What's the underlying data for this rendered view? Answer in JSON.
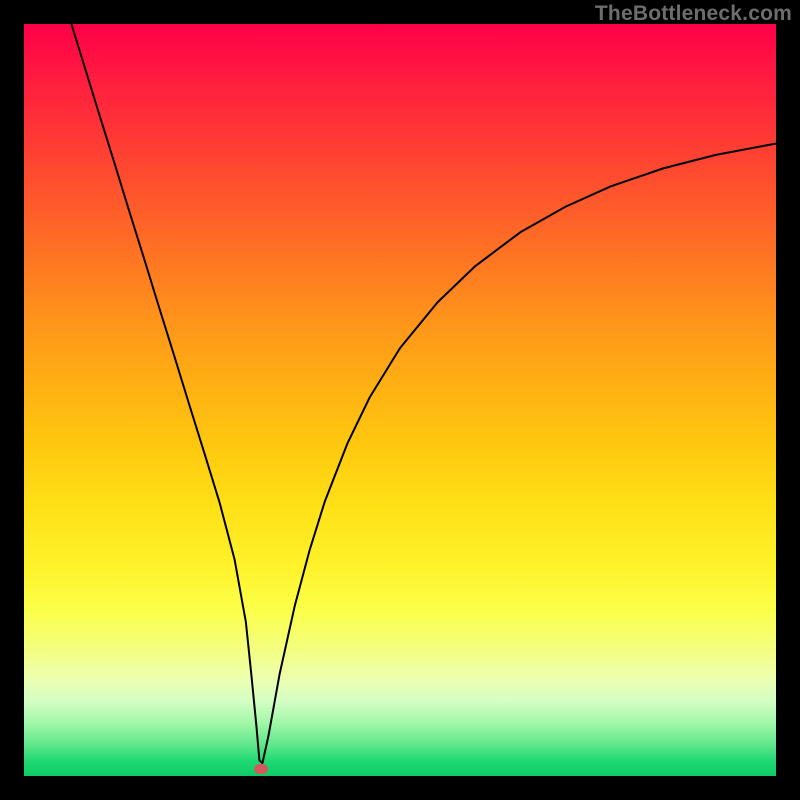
{
  "watermark": "TheBottleneck.com",
  "chart_data": {
    "type": "line",
    "title": "",
    "xlabel": "",
    "ylabel": "",
    "xlim": [
      0,
      100
    ],
    "ylim": [
      0,
      100
    ],
    "grid": false,
    "legend": false,
    "series": [
      {
        "name": "bottleneck-curve",
        "x": [
          6.3,
          8,
          10,
          12,
          14,
          16,
          18,
          20,
          22,
          24,
          26,
          28,
          29.5,
          30.2,
          30.9,
          31.3,
          31.7,
          32.5,
          34,
          36,
          38,
          40,
          43,
          46,
          50,
          55,
          60,
          66,
          72,
          78,
          85,
          92,
          100
        ],
        "y": [
          100,
          94.5,
          88,
          81.6,
          75.1,
          68.7,
          62.2,
          55.8,
          49.3,
          42.9,
          36.4,
          28.8,
          20.5,
          13.8,
          6.7,
          2.1,
          1.7,
          5.3,
          13.6,
          22.6,
          30.1,
          36.5,
          44.2,
          50.4,
          56.9,
          63,
          67.8,
          72.3,
          75.7,
          78.4,
          80.8,
          82.6,
          84.1
        ],
        "color": "#000000",
        "width": 2
      }
    ],
    "markers": [
      {
        "name": "optimal-point",
        "x": 31.5,
        "y": 0.9,
        "color": "#d35a5a",
        "shape": "rounded-rect"
      }
    ]
  }
}
